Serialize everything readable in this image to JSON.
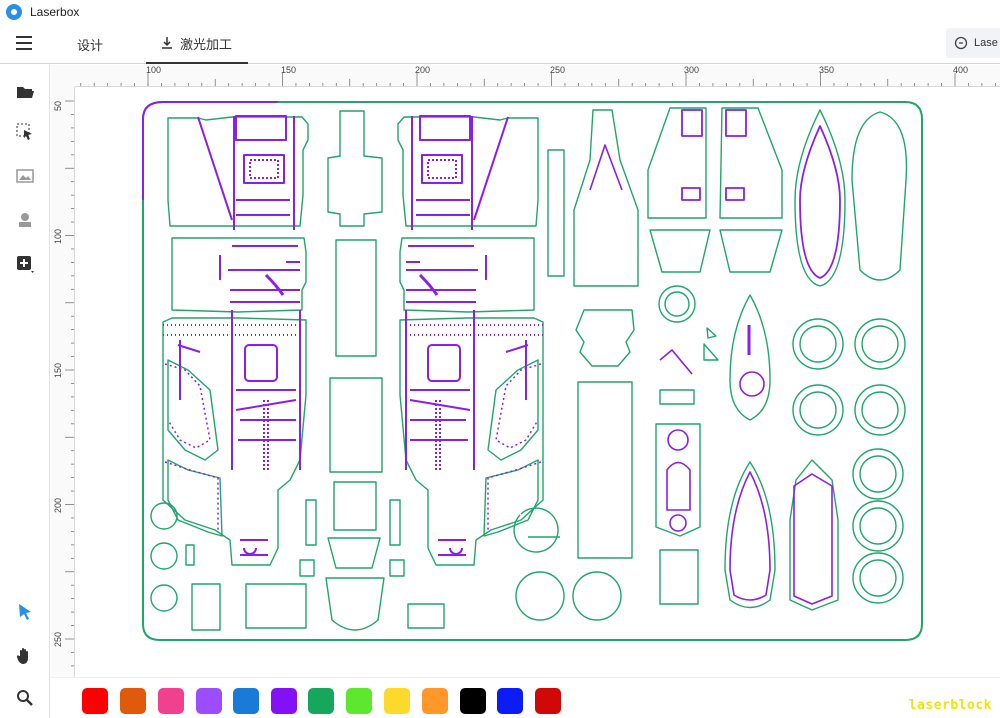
{
  "app": {
    "title": "Laserbox"
  },
  "tabs": {
    "design": "设计",
    "laser": "激光加工"
  },
  "cloud": {
    "label": "Lase"
  },
  "toolbar": {
    "tools": [
      {
        "name": "open-folder-icon"
      },
      {
        "name": "select-tool-icon"
      },
      {
        "name": "image-tool-icon"
      },
      {
        "name": "stamp-tool-icon"
      },
      {
        "name": "add-shape-icon"
      }
    ],
    "bottom_tools": [
      {
        "name": "pointer-tool-icon"
      },
      {
        "name": "hand-pan-icon"
      },
      {
        "name": "zoom-icon"
      }
    ]
  },
  "ruler": {
    "top_labels": [
      "100",
      "150",
      "200",
      "250",
      "300",
      "350",
      "400"
    ],
    "left_labels": [
      "50",
      "100",
      "150",
      "200",
      "250"
    ]
  },
  "colors": {
    "cut_green": "#1fa66a",
    "engrave_purple": "#8a1df0",
    "accent_blue": "#2a8fe6"
  },
  "palette": {
    "swatches": [
      "#ff0000",
      "#e05a0c",
      "#f0418f",
      "#9b4dff",
      "#1a7ad8",
      "#8410f5",
      "#16a85a",
      "#5de82d",
      "#fdd92b",
      "#ff9729",
      "#000000",
      "#0c1cf5",
      "#d10808"
    ]
  },
  "watermark": {
    "text": "laserblock"
  }
}
